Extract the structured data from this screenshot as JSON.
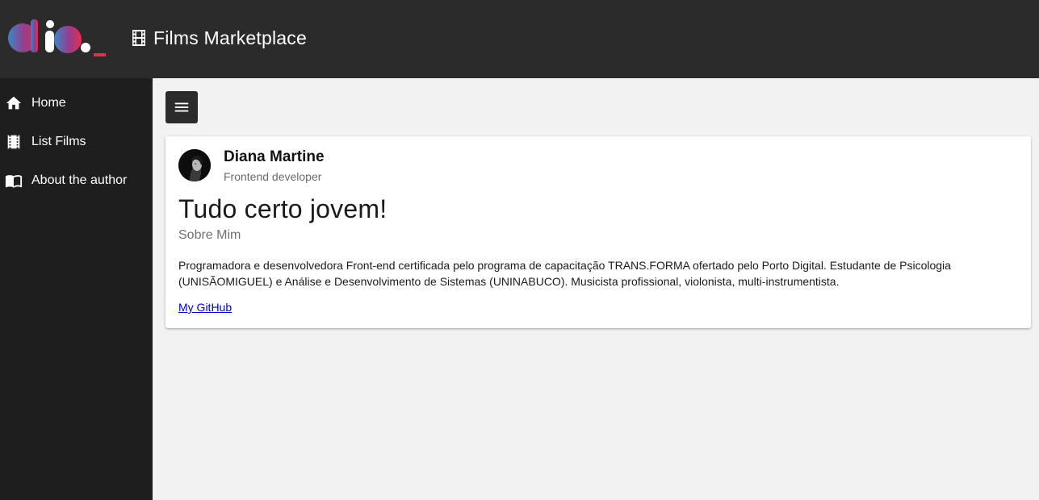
{
  "header": {
    "title": "Films Marketplace",
    "logo_text": "dio._",
    "logo_colors": {
      "start": "#3a86c8",
      "mid": "#a03a8a",
      "end": "#e0304a"
    }
  },
  "sidebar": {
    "items": [
      {
        "label": "Home",
        "icon": "home-icon"
      },
      {
        "label": "List Films",
        "icon": "film-icon"
      },
      {
        "label": "About the author",
        "icon": "book-icon"
      }
    ]
  },
  "toolbar": {
    "menu_icon": "hamburger-icon"
  },
  "profile": {
    "name": "Diana Martine",
    "role": "Frontend developer",
    "headline": "Tudo certo jovem!",
    "subheadline": "Sobre Mim",
    "bio": "Programadora e desenvolvedora Front-end certificada pelo programa de capacitação TRANS.FORMA ofertado pelo Porto Digital. Estudante de Psicologia (UNISÃOMIGUEL) e Análise e Desenvolvimento de Sistemas (UNINABUCO). Musicista profissional, violonista, multi-instrumentista.",
    "link_label": "My GitHub"
  },
  "colors": {
    "topbar": "#2b2b2b",
    "sidebar": "#1e1e1e",
    "background": "#f2f2f2",
    "link": "#0000cc"
  }
}
